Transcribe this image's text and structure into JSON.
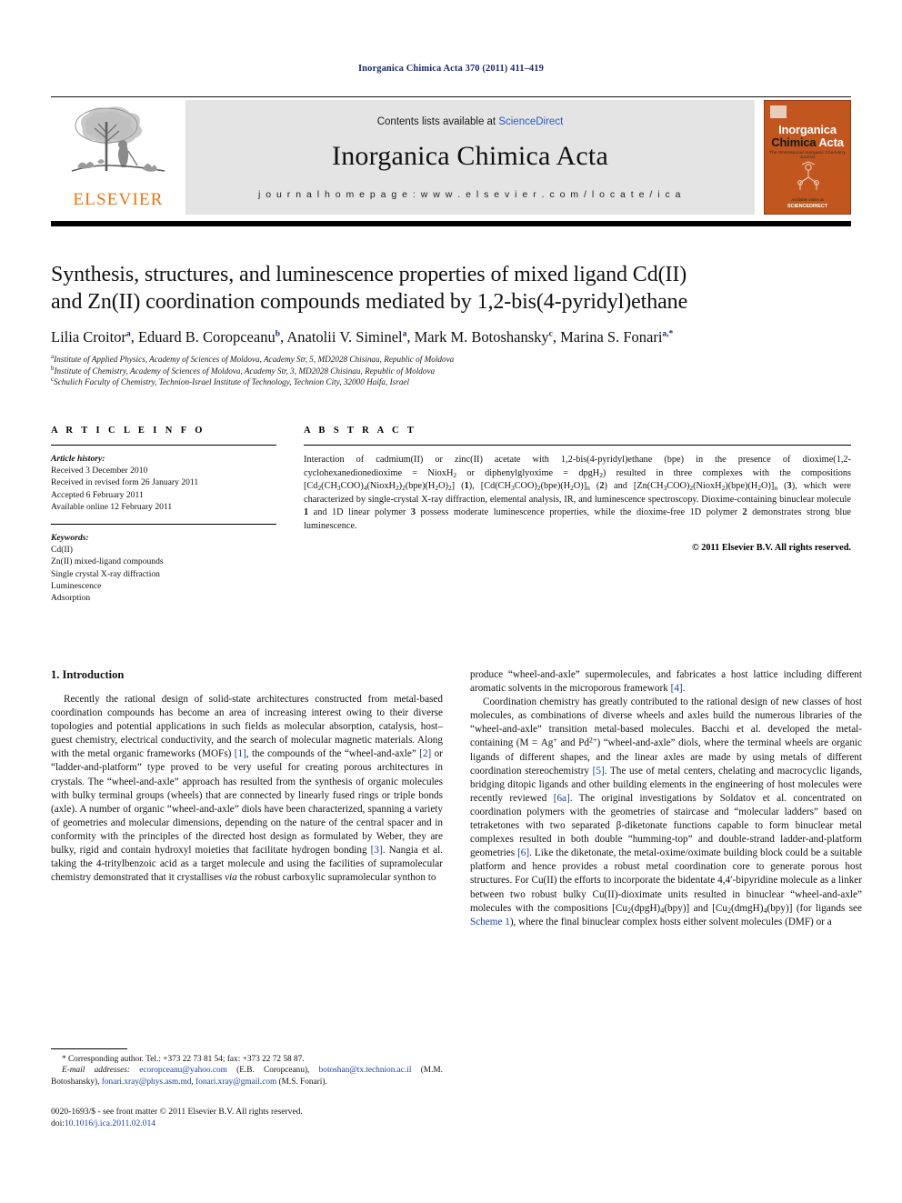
{
  "running_head": "Inorganica Chimica Acta 370 (2011) 411–419",
  "masthead": {
    "publisher_logo_label": "ELSEVIER",
    "contents_prefix": "Contents lists available at ",
    "contents_link": "ScienceDirect",
    "journal_title": "Inorganica Chimica Acta",
    "homepage_label": "j o u r n a l   h o m e p a g e :   w w w . e l s e v i e r . c o m / l o c a t e / i c a",
    "cover": {
      "line1": "Inorganica",
      "line2_a": "Chimica",
      "line2_b": "Acta",
      "subtitle": "The International Inorganic Chemistry Journal",
      "footer": "Available online at",
      "sciencedirect": "SCIENCEDIRECT",
      "bg_color": "#C1561F"
    }
  },
  "article": {
    "title_line1": "Synthesis, structures, and luminescence properties of mixed ligand Cd(II)",
    "title_line2": "and Zn(II) coordination compounds mediated by 1,2-bis(4-pyridyl)ethane",
    "authors": [
      {
        "name": "Lilia Croitor",
        "mark": "a",
        "sep": ", "
      },
      {
        "name": "Eduard B. Coropceanu",
        "mark": "b",
        "sep": ", "
      },
      {
        "name": "Anatolii V. Siminel",
        "mark": "a",
        "sep": ", "
      },
      {
        "name": "Mark M. Botoshansky",
        "mark": "c",
        "sep": ", "
      },
      {
        "name": "Marina S. Fonari",
        "mark": "a,*",
        "sep": ""
      }
    ],
    "affiliations": [
      {
        "mark": "a",
        "text": "Institute of Applied Physics, Academy of Sciences of Moldova, Academy Str, 5, MD2028 Chisinau, Republic of Moldova"
      },
      {
        "mark": "b",
        "text": "Institute of Chemistry, Academy of Sciences of Moldova, Academy Str, 3, MD2028 Chisinau, Republic of Moldova"
      },
      {
        "mark": "c",
        "text": "Schulich Faculty of Chemistry, Technion-Israel Institute of Technology, Technion City, 32000 Haifa, Israel"
      }
    ]
  },
  "article_info": {
    "heading": "A R T I C L E   I N F O",
    "history_label": "Article history:",
    "history": [
      "Received 3 December 2010",
      "Received in revised form 26 January 2011",
      "Accepted 6 February 2011",
      "Available online 12 February 2011"
    ],
    "keywords_label": "Keywords:",
    "keywords": [
      "Cd(II)",
      "Zn(II) mixed-ligand compounds",
      "Single crystal X-ray diffraction",
      "Luminescence",
      "Adsorption"
    ]
  },
  "abstract": {
    "heading": "A B S T R A C T",
    "copyright": "© 2011 Elsevier B.V. All rights reserved."
  },
  "intro": {
    "heading": "1. Introduction"
  },
  "footnote": {
    "corresponding": "* Corresponding author. Tel.: +373 22 73 81 54; fax: +373 22 72 58 87.",
    "email_label": "E-mail addresses:",
    "imprint": "0020-1693/$ - see front matter © 2011 Elsevier B.V. All rights reserved.",
    "doi_label": "doi:",
    "doi_value": "10.1016/j.ica.2011.02.014"
  },
  "colors": {
    "link": "#1a3fa0",
    "elsevier_orange": "#E87511",
    "masthead_bg": "#e4e4e4",
    "runhead": "#1a2a6c"
  }
}
